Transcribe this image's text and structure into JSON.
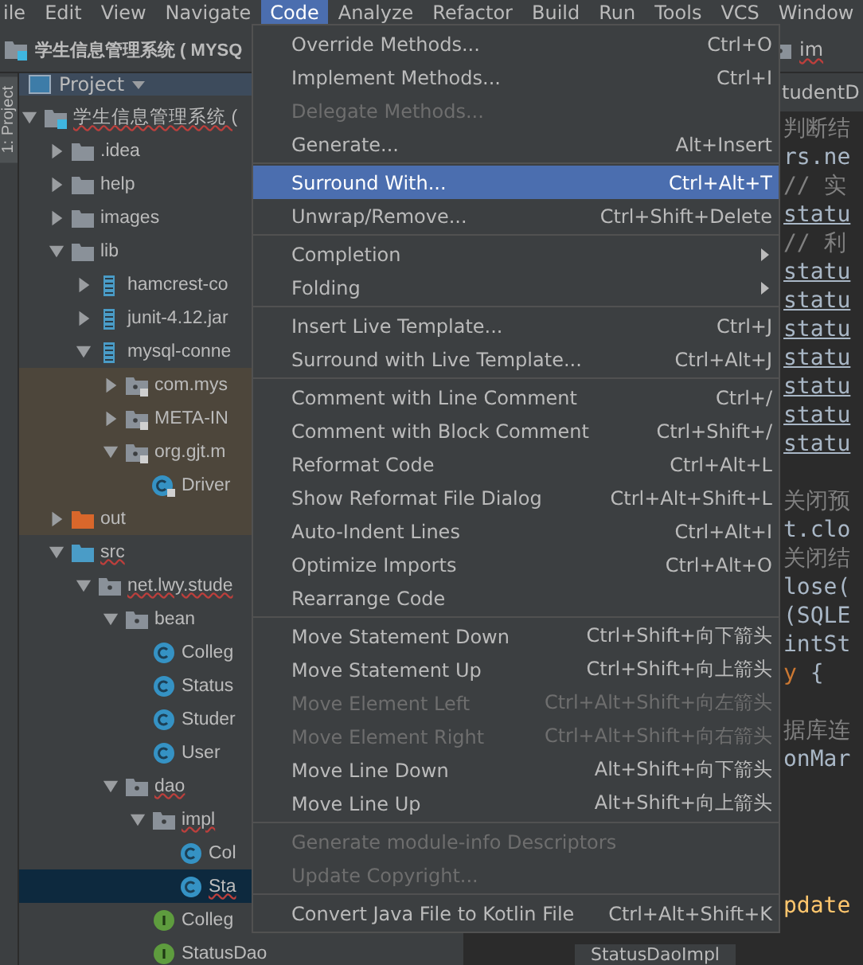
{
  "menu_bar": [
    {
      "label": "ile",
      "selected": false
    },
    {
      "label": "Edit",
      "selected": false
    },
    {
      "label": "View",
      "selected": false
    },
    {
      "label": "Navigate",
      "selected": false
    },
    {
      "label": "Code",
      "selected": true
    },
    {
      "label": "Analyze",
      "selected": false
    },
    {
      "label": "Refactor",
      "selected": false
    },
    {
      "label": "Build",
      "selected": false
    },
    {
      "label": "Run",
      "selected": false
    },
    {
      "label": "Tools",
      "selected": false
    },
    {
      "label": "VCS",
      "selected": false
    },
    {
      "label": "Window",
      "selected": false
    }
  ],
  "nav_bar": {
    "project": "学生信息管理系统 ( MYSQ",
    "crumb": "im"
  },
  "side_strip": {
    "label": "1: Project"
  },
  "project_panel": {
    "title": "Project",
    "tree": [
      {
        "name": "学生信息管理系统 (",
        "kind": "module",
        "expanded": true,
        "selected": false,
        "error": true,
        "tinted": false,
        "children": [
          {
            "name": ".idea",
            "kind": "folder",
            "expanded": false,
            "selected": false,
            "error": false,
            "tinted": false
          },
          {
            "name": "help",
            "kind": "folder",
            "expanded": false,
            "selected": false,
            "error": false,
            "tinted": false
          },
          {
            "name": "images",
            "kind": "folder",
            "expanded": false,
            "selected": false,
            "error": false,
            "tinted": false
          },
          {
            "name": "lib",
            "kind": "folder",
            "expanded": true,
            "selected": false,
            "error": false,
            "tinted": false,
            "children": [
              {
                "name": "hamcrest-co",
                "kind": "jar",
                "expanded": false,
                "selected": false,
                "error": false,
                "tinted": false
              },
              {
                "name": "junit-4.12.jar",
                "kind": "jar",
                "expanded": false,
                "selected": false,
                "error": false,
                "tinted": false
              },
              {
                "name": "mysql-conne",
                "kind": "jar",
                "expanded": true,
                "selected": false,
                "error": false,
                "tinted": false,
                "children": [
                  {
                    "name": "com.mys",
                    "kind": "package-locked",
                    "expanded": false,
                    "selected": false,
                    "error": false,
                    "tinted": true
                  },
                  {
                    "name": "META-IN",
                    "kind": "package-locked",
                    "expanded": false,
                    "selected": false,
                    "error": false,
                    "tinted": true
                  },
                  {
                    "name": "org.gjt.m",
                    "kind": "package-locked",
                    "expanded": true,
                    "selected": false,
                    "error": false,
                    "tinted": true,
                    "children": [
                      {
                        "name": "Driver",
                        "kind": "class-locked",
                        "selected": false,
                        "error": false,
                        "tinted": true
                      }
                    ]
                  }
                ]
              }
            ]
          },
          {
            "name": "out",
            "kind": "folder-excluded",
            "expanded": false,
            "selected": false,
            "error": false,
            "tinted": true
          },
          {
            "name": "src",
            "kind": "folder-source",
            "expanded": true,
            "selected": false,
            "error": true,
            "tinted": false,
            "children": [
              {
                "name": "net.lwy.stude",
                "kind": "package",
                "expanded": true,
                "selected": false,
                "error": true,
                "tinted": false,
                "children": [
                  {
                    "name": "bean",
                    "kind": "package",
                    "expanded": true,
                    "selected": false,
                    "error": false,
                    "tinted": false,
                    "children": [
                      {
                        "name": "Colleg",
                        "kind": "class",
                        "selected": false,
                        "error": false,
                        "tinted": false
                      },
                      {
                        "name": "Status",
                        "kind": "class",
                        "selected": false,
                        "error": false,
                        "tinted": false
                      },
                      {
                        "name": "Studer",
                        "kind": "class",
                        "selected": false,
                        "error": false,
                        "tinted": false
                      },
                      {
                        "name": "User",
                        "kind": "class",
                        "selected": false,
                        "error": false,
                        "tinted": false
                      }
                    ]
                  },
                  {
                    "name": "dao",
                    "kind": "package",
                    "expanded": true,
                    "selected": false,
                    "error": true,
                    "tinted": false,
                    "children": [
                      {
                        "name": "impl",
                        "kind": "package",
                        "expanded": true,
                        "selected": false,
                        "error": true,
                        "tinted": false,
                        "children": [
                          {
                            "name": "Col",
                            "kind": "class",
                            "selected": false,
                            "error": false,
                            "tinted": false
                          },
                          {
                            "name": "Sta",
                            "kind": "class",
                            "selected": true,
                            "error": true,
                            "tinted": false
                          }
                        ]
                      },
                      {
                        "name": "Colleg",
                        "kind": "interface",
                        "selected": false,
                        "error": false,
                        "tinted": false
                      },
                      {
                        "name": "StatusDao",
                        "kind": "interface",
                        "selected": false,
                        "error": false,
                        "tinted": false
                      }
                    ]
                  }
                ]
              }
            ]
          }
        ]
      }
    ]
  },
  "editor": {
    "tab": "tudentD",
    "blocks": [
      [
        [
          {
            "text": "判断结",
            "kind": "comment"
          }
        ],
        [
          {
            "text": "rs.ne",
            "kind": "code"
          }
        ],
        [
          {
            "text": "// 实",
            "kind": "comment"
          }
        ],
        [
          {
            "text": "statu",
            "kind": "static"
          }
        ],
        [
          {
            "text": "// 利",
            "kind": "comment"
          }
        ],
        [
          {
            "text": "statu",
            "kind": "static"
          }
        ],
        [
          {
            "text": "statu",
            "kind": "static"
          }
        ],
        [
          {
            "text": "statu",
            "kind": "static"
          }
        ],
        [
          {
            "text": "statu",
            "kind": "static"
          }
        ],
        [
          {
            "text": "statu",
            "kind": "static"
          }
        ],
        [
          {
            "text": "statu",
            "kind": "static"
          }
        ],
        [
          {
            "text": "statu",
            "kind": "static"
          }
        ]
      ],
      [
        [
          {
            "text": "关闭预",
            "kind": "comment"
          }
        ],
        [
          {
            "text": "t.clo",
            "kind": "code"
          }
        ],
        [
          {
            "text": "关闭结",
            "kind": "comment"
          }
        ],
        [
          {
            "text": "lose(",
            "kind": "code"
          }
        ],
        [
          {
            "text": "(SQLE",
            "kind": "code"
          }
        ],
        [
          {
            "text": "intSt",
            "kind": "code"
          }
        ],
        [
          {
            "text": "y",
            "kind": "keyword"
          },
          {
            "text": " {",
            "kind": "code"
          }
        ]
      ],
      [
        [
          {
            "text": "据库连",
            "kind": "comment"
          }
        ],
        [
          {
            "text": "onMar",
            "kind": "code"
          }
        ]
      ]
    ],
    "lower_lines": [
      [
        {
          "text": "pdate",
          "kind": "method"
        }
      ]
    ],
    "bottom_tab": "StatusDaoImpl"
  },
  "code_menu": {
    "groups": [
      [
        {
          "label": "Override Methods...",
          "shortcut": "Ctrl+O",
          "disabled": false,
          "selected": false
        },
        {
          "label": "Implement Methods...",
          "shortcut": "Ctrl+I",
          "disabled": false,
          "selected": false
        },
        {
          "label": "Delegate Methods...",
          "disabled": true,
          "selected": false
        },
        {
          "label": "Generate...",
          "shortcut": "Alt+Insert",
          "disabled": false,
          "selected": false
        }
      ],
      [
        {
          "label": "Surround With...",
          "shortcut": "Ctrl+Alt+T",
          "disabled": false,
          "selected": true
        },
        {
          "label": "Unwrap/Remove...",
          "shortcut": "Ctrl+Shift+Delete",
          "disabled": false,
          "selected": false
        }
      ],
      [
        {
          "label": "Completion",
          "submenu": true,
          "disabled": false,
          "selected": false
        },
        {
          "label": "Folding",
          "submenu": true,
          "disabled": false,
          "selected": false
        }
      ],
      [
        {
          "label": "Insert Live Template...",
          "shortcut": "Ctrl+J",
          "disabled": false,
          "selected": false
        },
        {
          "label": "Surround with Live Template...",
          "shortcut": "Ctrl+Alt+J",
          "disabled": false,
          "selected": false
        }
      ],
      [
        {
          "label": "Comment with Line Comment",
          "shortcut": "Ctrl+/",
          "disabled": false,
          "selected": false
        },
        {
          "label": "Comment with Block Comment",
          "shortcut": "Ctrl+Shift+/",
          "disabled": false,
          "selected": false
        },
        {
          "label": "Reformat Code",
          "shortcut": "Ctrl+Alt+L",
          "disabled": false,
          "selected": false
        },
        {
          "label": "Show Reformat File Dialog",
          "shortcut": "Ctrl+Alt+Shift+L",
          "disabled": false,
          "selected": false
        },
        {
          "label": "Auto-Indent Lines",
          "shortcut": "Ctrl+Alt+I",
          "disabled": false,
          "selected": false
        },
        {
          "label": "Optimize Imports",
          "shortcut": "Ctrl+Alt+O",
          "disabled": false,
          "selected": false
        },
        {
          "label": "Rearrange Code",
          "disabled": false,
          "selected": false
        }
      ],
      [
        {
          "label": "Move Statement Down",
          "shortcut": "Ctrl+Shift+向下箭头",
          "disabled": false,
          "selected": false
        },
        {
          "label": "Move Statement Up",
          "shortcut": "Ctrl+Shift+向上箭头",
          "disabled": false,
          "selected": false
        },
        {
          "label": "Move Element Left",
          "shortcut": "Ctrl+Alt+Shift+向左箭头",
          "disabled": true,
          "selected": false
        },
        {
          "label": "Move Element Right",
          "shortcut": "Ctrl+Alt+Shift+向右箭头",
          "disabled": true,
          "selected": false
        },
        {
          "label": "Move Line Down",
          "shortcut": "Alt+Shift+向下箭头",
          "disabled": false,
          "selected": false
        },
        {
          "label": "Move Line Up",
          "shortcut": "Alt+Shift+向上箭头",
          "disabled": false,
          "selected": false
        }
      ],
      [
        {
          "label": "Generate module-info Descriptors",
          "disabled": true,
          "selected": false
        },
        {
          "label": "Update Copyright...",
          "disabled": true,
          "selected": false
        }
      ],
      [
        {
          "label": "Convert Java File to Kotlin File",
          "shortcut": "Ctrl+Alt+Shift+K",
          "disabled": false,
          "selected": false
        }
      ]
    ]
  }
}
